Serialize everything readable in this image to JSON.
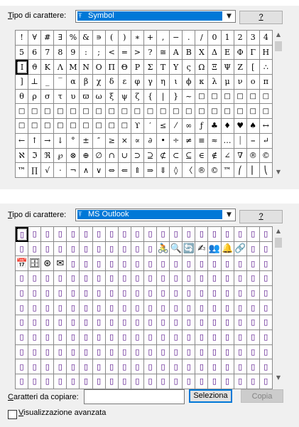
{
  "top": {
    "font_label_key": "T",
    "font_label_rest": "ipo di carattere:",
    "selected_font": "Symbol",
    "help_label": "?",
    "grid": [
      "!",
      "∀",
      "#",
      "∃",
      "%",
      "&",
      "∍",
      "(",
      ")",
      "∗",
      "+",
      ",",
      "−",
      ".",
      "/",
      "0",
      "1",
      "2",
      "3",
      "4",
      "5",
      "6",
      "7",
      "8",
      "9",
      ":",
      ";",
      "<",
      "=",
      ">",
      "?",
      "≅",
      "Α",
      "Β",
      "Χ",
      "Δ",
      "Ε",
      "Φ",
      "Γ",
      "Η",
      "Ι",
      "ϑ",
      "Κ",
      "Λ",
      "Μ",
      "Ν",
      "Ο",
      "Π",
      "Θ",
      "Ρ",
      "Σ",
      "Τ",
      "Υ",
      "ς",
      "Ω",
      "Ξ",
      "Ψ",
      "Ζ",
      "[",
      "∴",
      "]",
      "⊥",
      "_",
      "‾",
      "α",
      "β",
      "χ",
      "δ",
      "ε",
      "φ",
      "γ",
      "η",
      "ι",
      "ϕ",
      "κ",
      "λ",
      "μ",
      "ν",
      "ο",
      "π",
      "θ",
      "ρ",
      "σ",
      "τ",
      "υ",
      "ϖ",
      "ω",
      "ξ",
      "ψ",
      "ζ",
      "{",
      "|",
      "}",
      "~",
      "□",
      "□",
      "□",
      "□",
      "□",
      "□",
      "□",
      "□",
      "□",
      "□",
      "□",
      "□",
      "□",
      "□",
      "□",
      "□",
      "□",
      "□",
      "□",
      "□",
      "□",
      "□",
      "□",
      "□",
      "□",
      "□",
      "□",
      "□",
      "□",
      "□",
      "□",
      "□",
      "□",
      "□",
      "□",
      "ϒ",
      "′",
      "≤",
      "⁄",
      "∞",
      "ƒ",
      "♣",
      "♦",
      "♥",
      "♠",
      "↔",
      "←",
      "↑",
      "→",
      "↓",
      "°",
      "±",
      "″",
      "≥",
      "×",
      "∝",
      "∂",
      "•",
      "÷",
      "≠",
      "≡",
      "≈",
      "…",
      "⏐",
      "⎯",
      "↵",
      "ℵ",
      "ℑ",
      "ℜ",
      "℘",
      "⊗",
      "⊕",
      "∅",
      "∩",
      "∪",
      "⊃",
      "⊇",
      "⊄",
      "⊂",
      "⊆",
      "∈",
      "∉",
      "∠",
      "∇",
      "®",
      "©",
      "™",
      "∏",
      "√",
      "⋅",
      "¬",
      "∧",
      "∨",
      "⇔",
      "⇐",
      "⇑",
      "⇒",
      "⇓",
      "◊",
      "〈",
      "®",
      "©",
      "™",
      "⎛",
      "⎜",
      "⎝"
    ]
  },
  "bottom": {
    "font_label_key": "T",
    "font_label_rest": "ipo di carattere:",
    "selected_font": "MS Outlook",
    "help_label": "?",
    "glyph_row1": [
      "🚴",
      "🔍",
      "🔄",
      "✍",
      "👥",
      "🔔",
      "🔗"
    ],
    "glyph_row2": [
      "📅",
      "🗄",
      "⊛",
      "✉"
    ],
    "copy_label_key": "C",
    "copy_label_rest": "aratteri da copiare:",
    "copy_value": "",
    "select_button": "Seleziona",
    "copy_button": "Copia",
    "advanced_key": "V",
    "advanced_rest": "isualizzazione avanzata",
    "advanced_checked": false,
    "empty_glyph": "▯"
  }
}
